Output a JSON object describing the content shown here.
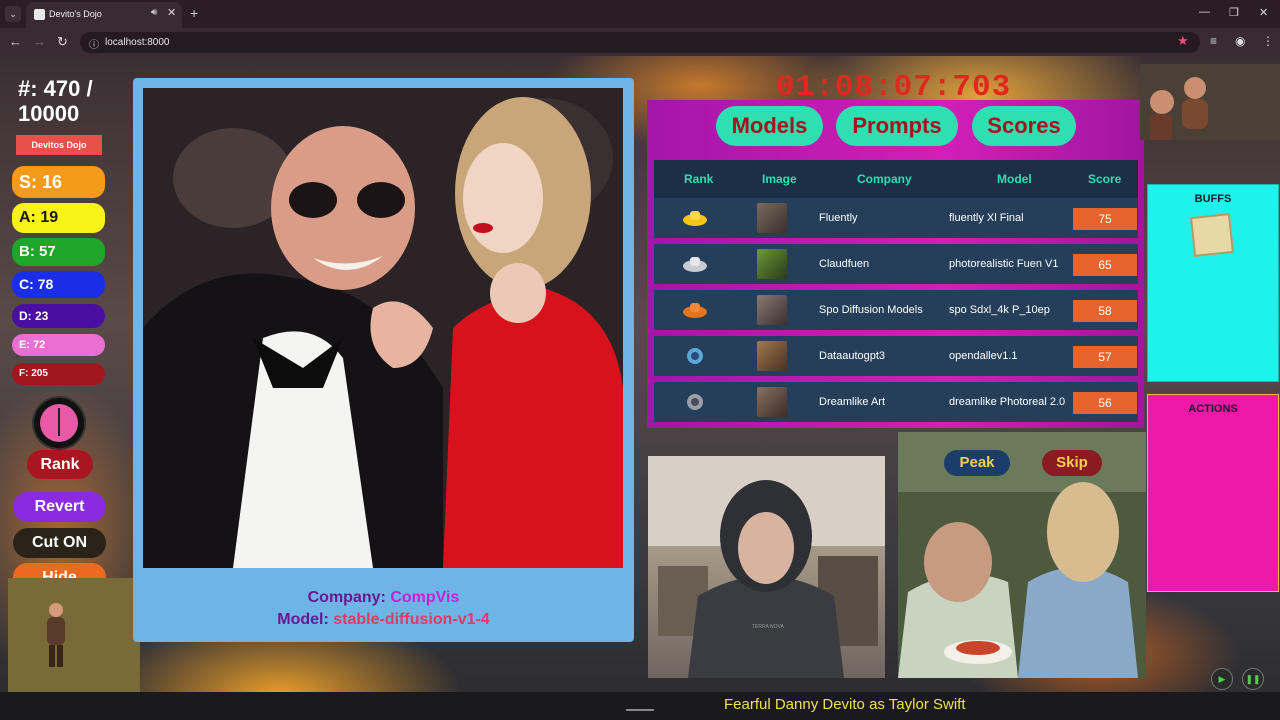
{
  "browser": {
    "tab_title": "Devito's Dojo",
    "url": "localhost:8000"
  },
  "counter": "#: 470 / 10000",
  "dojo_label": "Devitos Dojo",
  "tiers": [
    {
      "label": "S: 16",
      "color": "#f59a1b",
      "text_color": "#ffffff"
    },
    {
      "label": "A: 19",
      "color": "#f7f319",
      "text_color": "#1a1a1a"
    },
    {
      "label": "B: 57",
      "color": "#1fa52a",
      "text_color": "#ffffff"
    },
    {
      "label": "C: 78",
      "color": "#1a2ee8",
      "text_color": "#ffffff"
    },
    {
      "label": "D: 23",
      "color": "#4a0fa2",
      "text_color": "#ffffff"
    },
    {
      "label": "E: 72",
      "color": "#ea6fd3",
      "text_color": "#ffffff"
    },
    {
      "label": "F: 205",
      "color": "#a2161d",
      "text_color": "#ffffff"
    }
  ],
  "buttons": {
    "rank": "Rank",
    "revert": "Revert",
    "cut": "Cut ON",
    "hide": "Hide",
    "peak": "Peak",
    "skip": "Skip"
  },
  "main_image": {
    "company_label": "Company:",
    "company_value": "CompVis",
    "model_label": "Model:",
    "model_value": "stable-diffusion-v1-4"
  },
  "timer": "01:08:07:703",
  "leaderboard": {
    "tabs": [
      "Models",
      "Prompts",
      "Scores"
    ],
    "columns": [
      "Rank",
      "Image",
      "Company",
      "Model",
      "Score"
    ],
    "rows": [
      {
        "rank_icon": "gold-trophy-icon",
        "company": "Fluently",
        "model": "fluently Xl Final",
        "score": "75"
      },
      {
        "rank_icon": "silver-trophy-icon",
        "company": "Claudfuen",
        "model": "photorealistic Fuen V1",
        "score": "65"
      },
      {
        "rank_icon": "bronze-trophy-icon",
        "company": "Spo Diffusion Models",
        "model": "spo Sdxl_4k P_10ep",
        "score": "58"
      },
      {
        "rank_icon": "blue-badge-icon",
        "company": "Dataautogpt3",
        "model": "opendallev1.1",
        "score": "57"
      },
      {
        "rank_icon": "gray-badge-icon",
        "company": "Dreamlike Art",
        "model": "dreamlike Photoreal 2.0",
        "score": "56"
      }
    ]
  },
  "webcam_shirt_text": "TERRA NOVA",
  "panels": {
    "buffs": "BUFFS",
    "actions": "ACTIONS"
  },
  "prompt": "Fearful Danny Devito as Taylor Swift"
}
